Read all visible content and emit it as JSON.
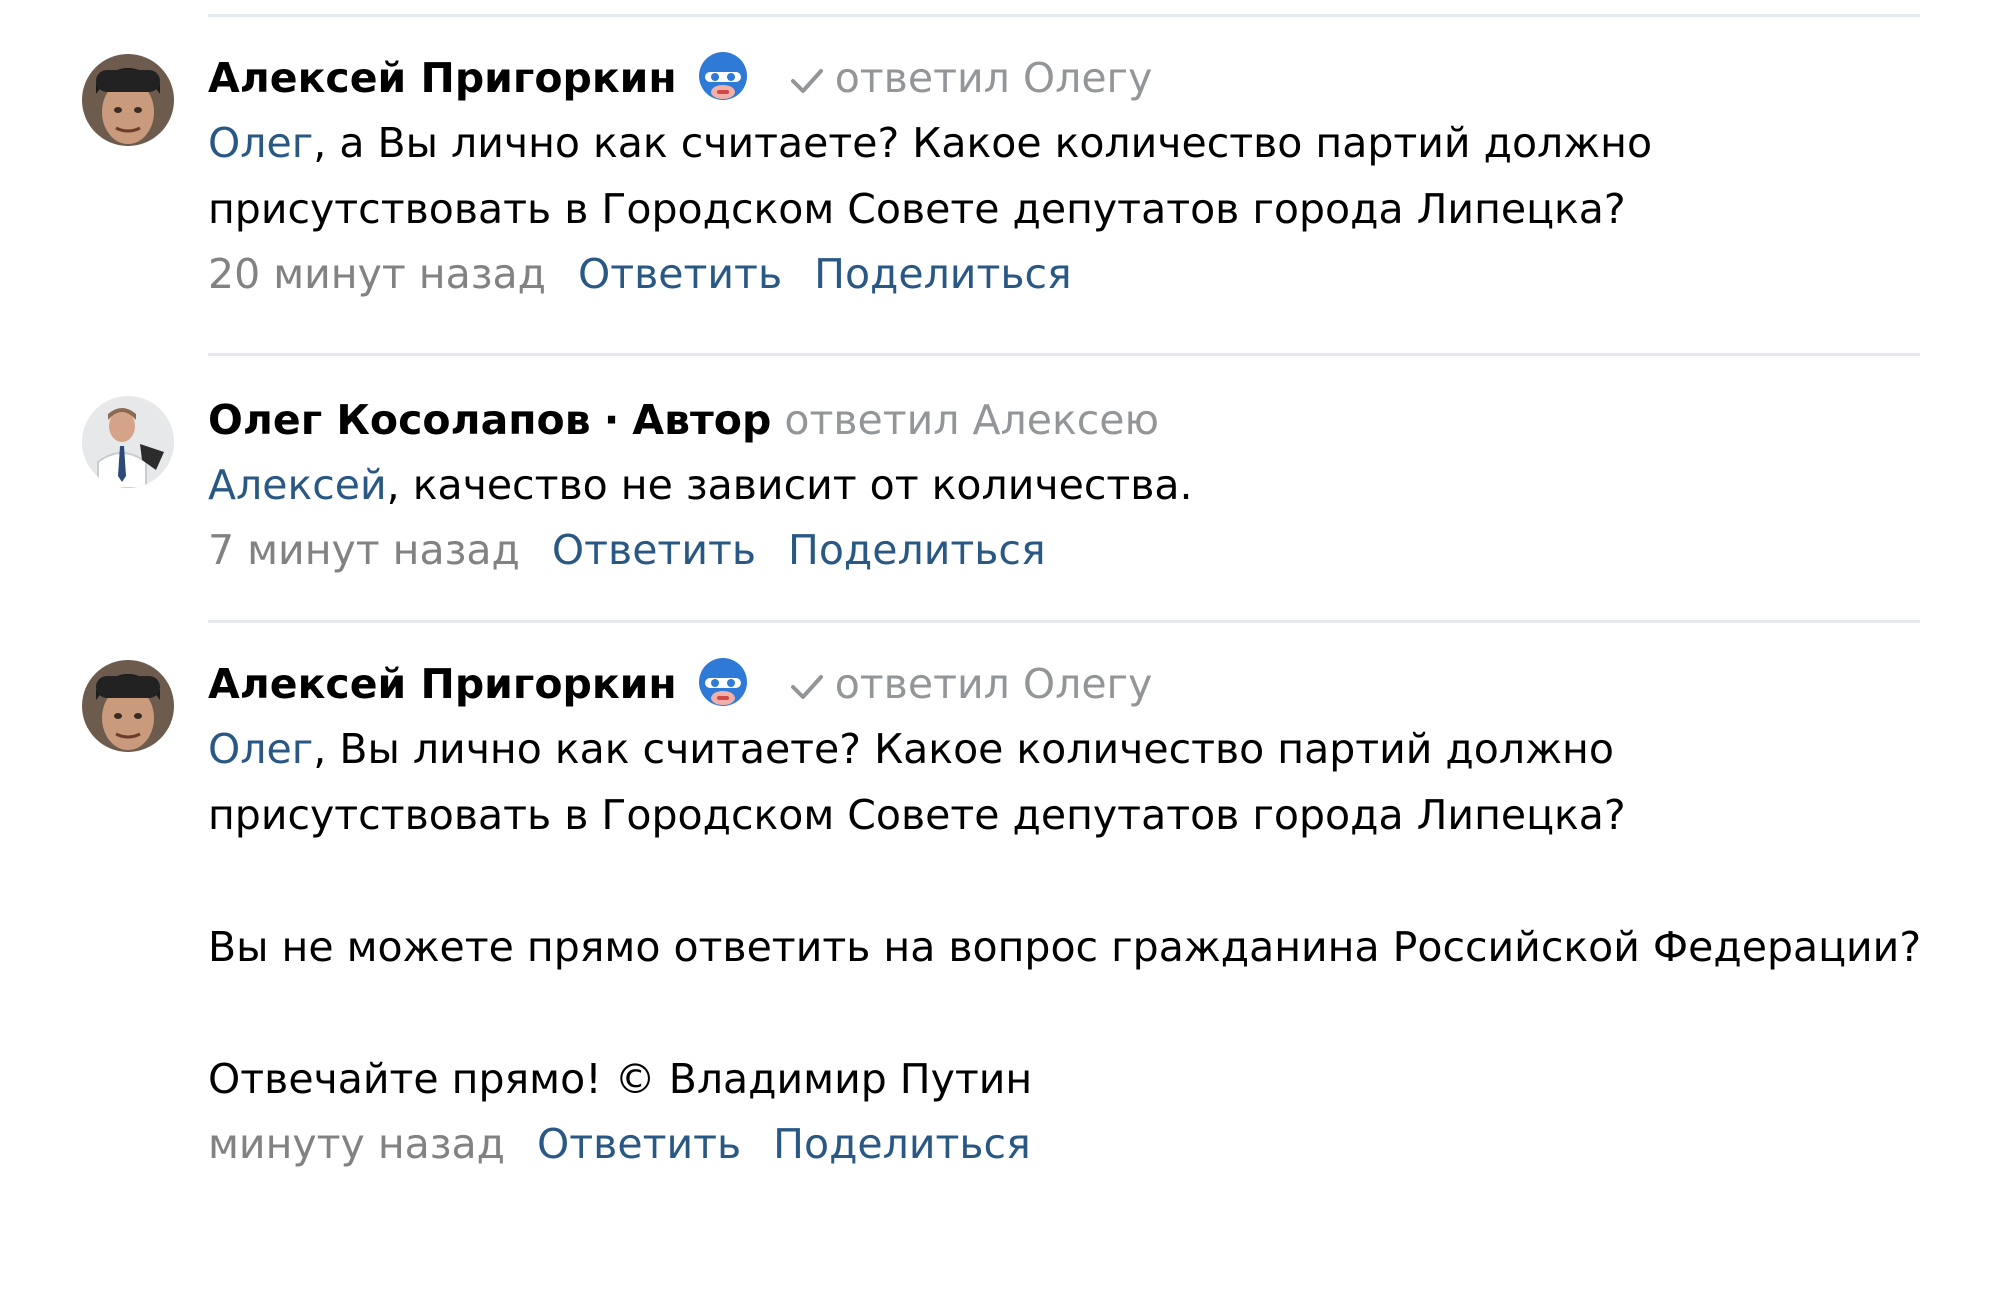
{
  "colors": {
    "link": "#2a5885",
    "muted": "#939699",
    "divider": "#e5e8ec"
  },
  "comments": [
    {
      "author": "Алексей Пригоркин",
      "badge_icon": "superhero-badge-icon",
      "verified_icon": "check-icon",
      "reply_to": "ответил Олегу",
      "mention": "Олег",
      "text": ", а Вы лично как считаете? Какое количество партий должно присутствовать в Городском Совете депутатов города Липецка?",
      "time": "20 минут назад",
      "reply_label": "Ответить",
      "share_label": "Поделиться"
    },
    {
      "author": "Олег Косолапов",
      "separator": "·",
      "role": "Автор",
      "reply_to": "ответил Алексею",
      "mention": "Алексей",
      "text": ", качество не зависит от количества.",
      "time": "7 минут назад",
      "reply_label": "Ответить",
      "share_label": "Поделиться"
    },
    {
      "author": "Алексей Пригоркин",
      "badge_icon": "superhero-badge-icon",
      "verified_icon": "check-icon",
      "reply_to": "ответил Олегу",
      "mention": "Олег",
      "text": ", Вы лично как считаете? Какое количество партий должно присутствовать в Городском Совете депутатов города Липецка?\n\nВы не можете прямо ответить на вопрос гражданина Российской Федерации?\n\nОтвечайте прямо! © Владимир Путин",
      "time": "минуту назад",
      "reply_label": "Ответить",
      "share_label": "Поделиться"
    }
  ]
}
